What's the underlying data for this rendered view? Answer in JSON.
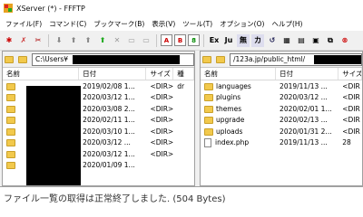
{
  "window": {
    "title": "XServer (*) - FFFTP"
  },
  "menu": [
    "ファイル(F)",
    "コマンド(C)",
    "ブックマーク(B)",
    "表示(V)",
    "ツール(T)",
    "オプション(O)",
    "ヘルプ(H)"
  ],
  "toolbar": {
    "buttons": [
      "connect-icon",
      "disconnect-icon",
      "download-icon",
      "upload-icon",
      "refresh-icon",
      "cancel-icon"
    ],
    "mode_a": "A",
    "mode_b": "B",
    "mode_8": "8",
    "ex": "Ex",
    "jis": "Ju",
    "kana": "カ"
  },
  "colors": {
    "accent": "#e0a020",
    "status_text": "#333333"
  },
  "left": {
    "path": "C:\\Users¥",
    "columns": [
      "名前",
      "日付",
      "サイズ",
      "種"
    ],
    "rows": [
      {
        "date": "2019/02/08 1...",
        "size": "<DIR>",
        "type": "dr"
      },
      {
        "date": "2020/03/12 1...",
        "size": "<DIR>",
        "type": ""
      },
      {
        "date": "2020/03/08 2...",
        "size": "<DIR>",
        "type": ""
      },
      {
        "date": "2020/02/11 1...",
        "size": "<DIR>",
        "type": ""
      },
      {
        "date": "2020/03/10 1...",
        "size": "<DIR>",
        "type": ""
      },
      {
        "date": "2020/03/12 ...",
        "size": "<DIR>",
        "type": ""
      },
      {
        "date": "2020/03/12 1...",
        "size": "<DIR>",
        "type": ""
      },
      {
        "date": "2020/01/09 1...",
        "size": "",
        "type": ""
      }
    ]
  },
  "right": {
    "path": "/123a.jp/public_html/",
    "columns": [
      "名前",
      "日付",
      "サイズ"
    ],
    "rows": [
      {
        "name": "languages",
        "date": "2019/11/13 ...",
        "size": "<DIR",
        "kind": "folder"
      },
      {
        "name": "plugins",
        "date": "2020/03/12 ...",
        "size": "<DIR",
        "kind": "folder"
      },
      {
        "name": "themes",
        "date": "2020/02/01 1...",
        "size": "<DIR",
        "kind": "folder"
      },
      {
        "name": "upgrade",
        "date": "2020/02/13 ...",
        "size": "<DIR",
        "kind": "folder"
      },
      {
        "name": "uploads",
        "date": "2020/01/31 2...",
        "size": "<DIR",
        "kind": "folder"
      },
      {
        "name": "index.php",
        "date": "2019/11/13 ...",
        "size": "28",
        "kind": "file"
      }
    ]
  },
  "status": {
    "message": "ファイル一覧の取得は正常終了しました. (504 Bytes)"
  }
}
